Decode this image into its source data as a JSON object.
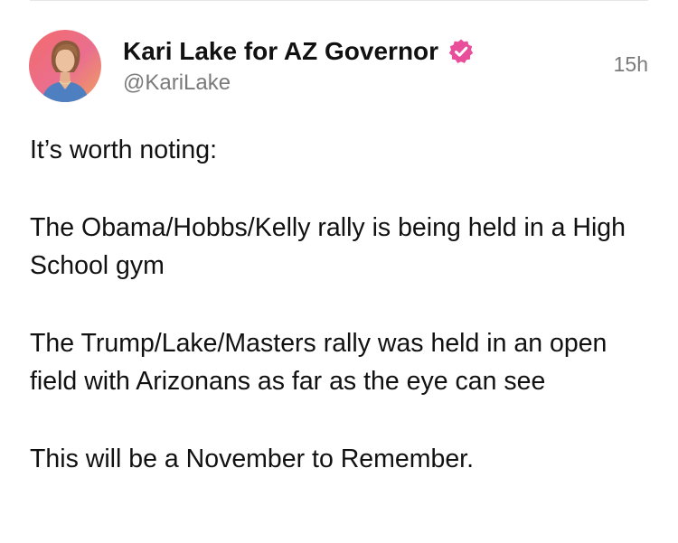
{
  "post": {
    "author": {
      "display_name": "Kari Lake for AZ Governor",
      "handle": "@KariLake",
      "verified_icon": "verified-badge-icon",
      "badge_color": "#e94e9a"
    },
    "timestamp": "15h",
    "paragraphs": [
      "It’s worth noting:",
      "The Obama/Hobbs/Kelly rally is being held in a High School gym",
      "The Trump/Lake/Masters rally was held in an open field with Arizonans as far as the eye can see",
      "This will be a November to Remember."
    ]
  }
}
